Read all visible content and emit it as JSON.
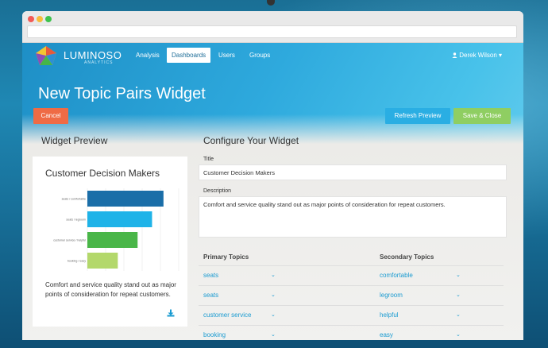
{
  "nav": {
    "brand": "LUMINOSO",
    "brand_sub": "ANALYTICS",
    "links": [
      "Analysis",
      "Dashboards",
      "Users",
      "Groups"
    ],
    "active": "Dashboards",
    "user": "Derek Wilson ▾"
  },
  "page": {
    "title": "New Topic Pairs Widget",
    "cancel_label": "Cancel",
    "refresh_label": "Refresh Preview",
    "save_label": "Save & Close"
  },
  "preview": {
    "heading": "Widget Preview",
    "card_title": "Customer Decision Makers",
    "card_text": "Comfort and service quality stand out as major points of consideration for repeat customers."
  },
  "chart_data": {
    "type": "bar",
    "orientation": "horizontal",
    "categories": [
      "seats / comfortable",
      "seats / legroom",
      "customer service / helpful",
      "booking / easy"
    ],
    "values": [
      100,
      85,
      66,
      40
    ],
    "colors": [
      "#1a6ea8",
      "#1fb3e8",
      "#49b648",
      "#b3d86b"
    ],
    "title": "",
    "xlabel": "",
    "ylabel": "",
    "xlim": [
      0,
      120
    ],
    "grid": true
  },
  "configure": {
    "heading": "Configure Your Widget",
    "title_label": "Title",
    "title_value": "Customer Decision Makers",
    "desc_label": "Description",
    "desc_value": "Comfort and service quality stand out as major points of consideration for repeat customers.",
    "primary_heading": "Primary Topics",
    "secondary_heading": "Secondary Topics",
    "primary": [
      "seats",
      "seats",
      "customer service",
      "booking"
    ],
    "secondary": [
      "comfortable",
      "legroom",
      "helpful",
      "easy"
    ]
  },
  "colors": {
    "cancel": "#ef6b45",
    "refresh": "#2aaee3",
    "save": "#8fce62",
    "link": "#1a9bd1"
  },
  "icons": {
    "user": "person-icon",
    "download": "download-icon",
    "chevron": "chevron-down-icon"
  }
}
